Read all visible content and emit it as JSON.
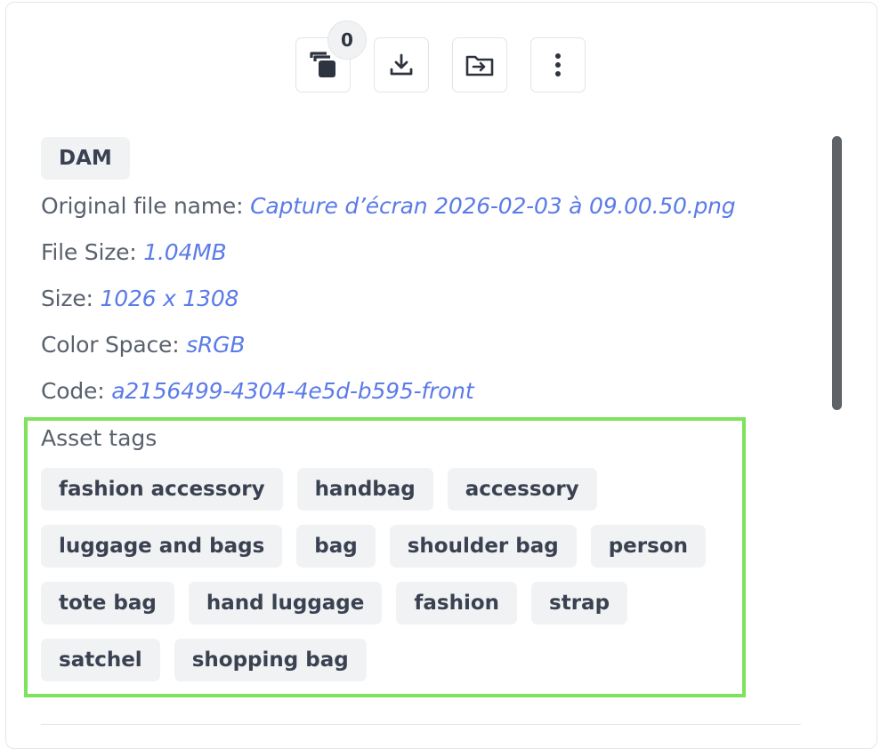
{
  "toolbar": {
    "selection_count": "0",
    "buttons": [
      {
        "icon": "copy-stack-icon"
      },
      {
        "icon": "download-icon"
      },
      {
        "icon": "move-to-folder-icon"
      },
      {
        "icon": "more-vertical-icon"
      }
    ]
  },
  "source_badge": "DAM",
  "metadata": [
    {
      "label": "Original file name:",
      "value": "Capture d’écran 2026-02-03 à 09.00.50.png"
    },
    {
      "label": "File Size:",
      "value": "1.04MB"
    },
    {
      "label": "Size:",
      "value": "1026 x 1308"
    },
    {
      "label": "Color Space:",
      "value": "sRGB"
    },
    {
      "label": "Code:",
      "value": "a2156499-4304-4e5d-b595-front"
    }
  ],
  "asset_tags": {
    "title": "Asset tags",
    "tags": [
      "fashion accessory",
      "handbag",
      "accessory",
      "luggage and bags",
      "bag",
      "shoulder bag",
      "person",
      "tote bag",
      "hand luggage",
      "fashion",
      "strap",
      "satchel",
      "shopping bag"
    ]
  },
  "colors": {
    "value_link": "#5b7be8",
    "highlight_frame": "#7de35a",
    "chip_bg": "#f1f2f4"
  }
}
